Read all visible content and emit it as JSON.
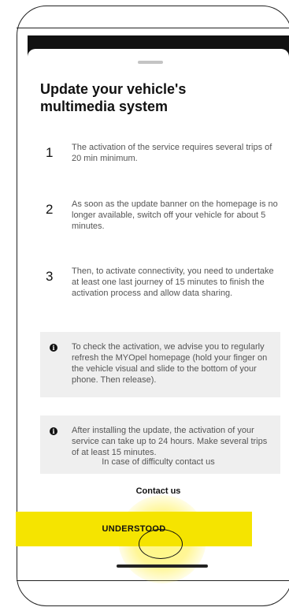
{
  "title": "Update your vehicle's multimedia system",
  "steps": [
    {
      "number": "1",
      "text": "The activation of the service requires several trips of 20 min minimum."
    },
    {
      "number": "2",
      "text": "As soon as the update banner on the homepage is no longer available, switch off your vehicle for about 5 minutes."
    },
    {
      "number": "3",
      "text": "Then, to activate connectivity, you need to undertake at least one last journey of 15 minutes to finish the activation process and allow data sharing."
    }
  ],
  "info_boxes": [
    {
      "icon": "info-icon",
      "text": "To check the activation, we advise you to regularly refresh the MYOpel homepage (hold your finger on the vehicle visual and slide to the bottom of your phone. Then release)."
    },
    {
      "icon": "info-icon",
      "text": "After installing the update, the activation of your service can take up to 24 hours. Make several trips of at least 15 minutes."
    }
  ],
  "help_text": "In case of difficulty contact us",
  "contact_link": "Contact us",
  "cta_label": "UNDERSTOOD",
  "colors": {
    "accent": "#f5e400",
    "info_bg": "#efefef",
    "text": "#111111"
  }
}
